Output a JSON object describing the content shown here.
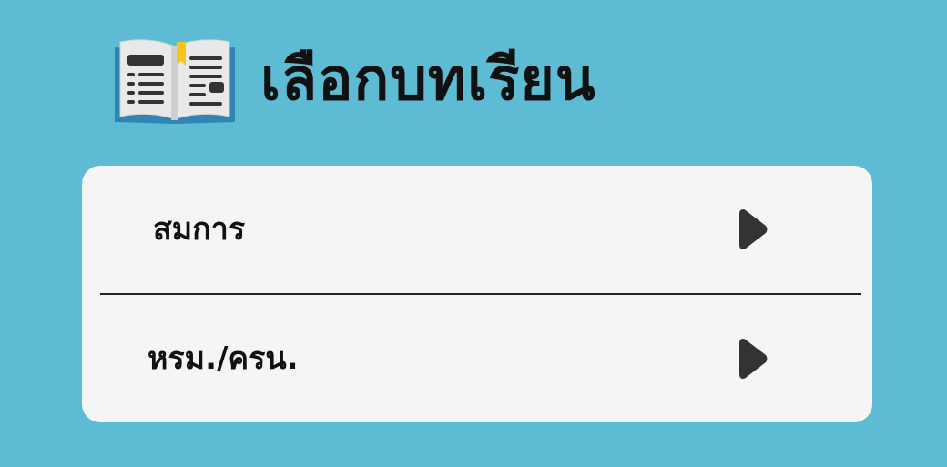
{
  "header": {
    "icon": "open-book-icon",
    "title": "เลือกบทเรียน"
  },
  "menu": {
    "items": [
      {
        "label": "สมการ",
        "icon": "play-arrow-icon"
      },
      {
        "label": "หรม./ครน.",
        "icon": "play-arrow-icon"
      }
    ]
  },
  "colors": {
    "background": "#5dbcd3",
    "card": "#f5f5f5",
    "text": "#111111",
    "arrow": "#333333",
    "book_cover": "#2f86b4",
    "bookmark": "#f5c518"
  }
}
